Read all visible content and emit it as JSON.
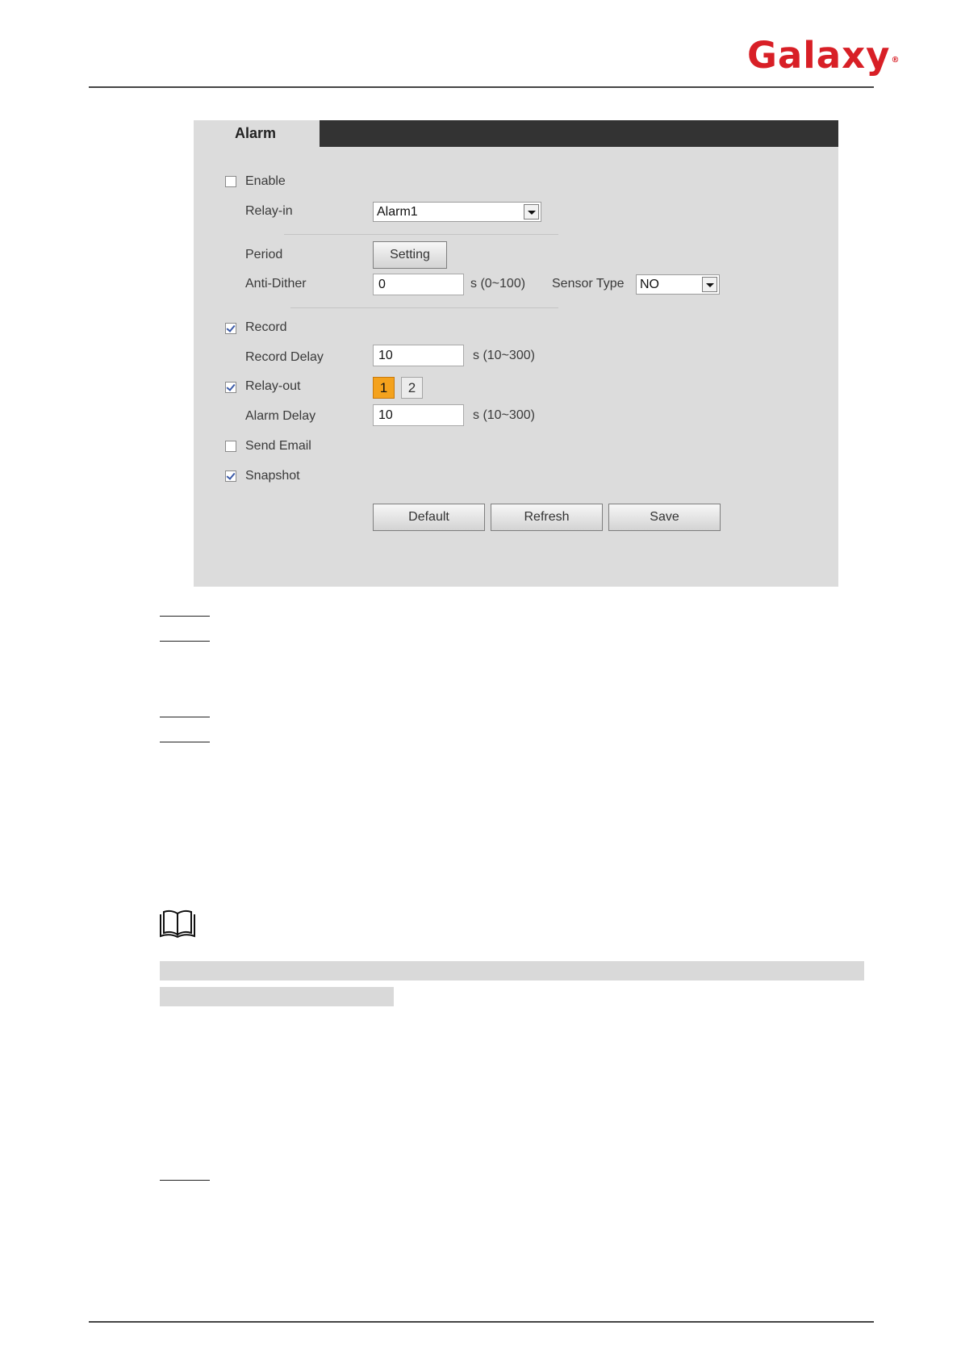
{
  "header": {
    "logo_text": "Galaxy",
    "logo_mark": "®"
  },
  "alarm_panel": {
    "tab": "Alarm",
    "enable": {
      "label": "Enable",
      "checked": false
    },
    "relay_in": {
      "label": "Relay-in",
      "value": "Alarm1"
    },
    "period": {
      "label": "Period",
      "button": "Setting"
    },
    "anti_dither": {
      "label": "Anti-Dither",
      "value": "0",
      "unit": "s (0~100)"
    },
    "sensor_type": {
      "label": "Sensor Type",
      "value": "NO"
    },
    "record": {
      "label": "Record",
      "checked": true
    },
    "record_delay": {
      "label": "Record Delay",
      "value": "10",
      "unit": "s (10~300)"
    },
    "relay_out": {
      "label": "Relay-out",
      "checked": true,
      "channels": [
        "1",
        "2"
      ],
      "selected": "1"
    },
    "alarm_delay": {
      "label": "Alarm Delay",
      "value": "10",
      "unit": "s (10~300)"
    },
    "send_email": {
      "label": "Send Email",
      "checked": false
    },
    "snapshot": {
      "label": "Snapshot",
      "checked": true
    },
    "buttons": {
      "default": "Default",
      "refresh": "Refresh",
      "save": "Save"
    }
  },
  "colors": {
    "logo": "#d81f26",
    "panel_bg": "#dcdcdc",
    "header_bar": "#333333",
    "selected_channel": "#f4a21d"
  },
  "icons": {
    "note": "book-icon"
  }
}
